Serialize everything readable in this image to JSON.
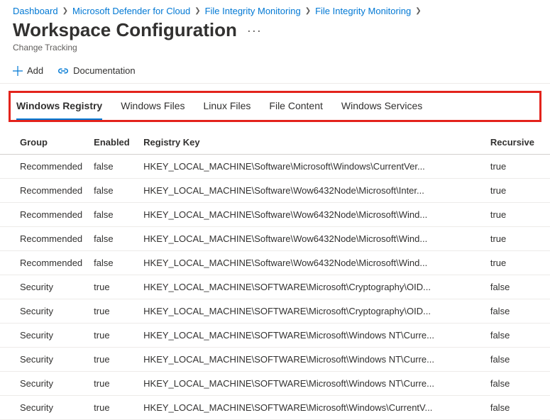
{
  "breadcrumb": {
    "items": [
      {
        "label": "Dashboard"
      },
      {
        "label": "Microsoft Defender for Cloud"
      },
      {
        "label": "File Integrity Monitoring"
      },
      {
        "label": "File Integrity Monitoring"
      }
    ]
  },
  "header": {
    "title": "Workspace Configuration",
    "subtitle": "Change Tracking"
  },
  "toolbar": {
    "add_label": "Add",
    "doc_label": "Documentation"
  },
  "tabs": [
    {
      "label": "Windows Registry",
      "active": true
    },
    {
      "label": "Windows Files",
      "active": false
    },
    {
      "label": "Linux Files",
      "active": false
    },
    {
      "label": "File Content",
      "active": false
    },
    {
      "label": "Windows Services",
      "active": false
    }
  ],
  "table": {
    "headers": {
      "group": "Group",
      "enabled": "Enabled",
      "key": "Registry Key",
      "recursive": "Recursive"
    },
    "rows": [
      {
        "group": "Recommended",
        "enabled": "false",
        "key": "HKEY_LOCAL_MACHINE\\Software\\Microsoft\\Windows\\CurrentVer...",
        "recursive": "true"
      },
      {
        "group": "Recommended",
        "enabled": "false",
        "key": "HKEY_LOCAL_MACHINE\\Software\\Wow6432Node\\Microsoft\\Inter...",
        "recursive": "true"
      },
      {
        "group": "Recommended",
        "enabled": "false",
        "key": "HKEY_LOCAL_MACHINE\\Software\\Wow6432Node\\Microsoft\\Wind...",
        "recursive": "true"
      },
      {
        "group": "Recommended",
        "enabled": "false",
        "key": "HKEY_LOCAL_MACHINE\\Software\\Wow6432Node\\Microsoft\\Wind...",
        "recursive": "true"
      },
      {
        "group": "Recommended",
        "enabled": "false",
        "key": "HKEY_LOCAL_MACHINE\\Software\\Wow6432Node\\Microsoft\\Wind...",
        "recursive": "true"
      },
      {
        "group": "Security",
        "enabled": "true",
        "key": "HKEY_LOCAL_MACHINE\\SOFTWARE\\Microsoft\\Cryptography\\OID...",
        "recursive": "false"
      },
      {
        "group": "Security",
        "enabled": "true",
        "key": "HKEY_LOCAL_MACHINE\\SOFTWARE\\Microsoft\\Cryptography\\OID...",
        "recursive": "false"
      },
      {
        "group": "Security",
        "enabled": "true",
        "key": "HKEY_LOCAL_MACHINE\\SOFTWARE\\Microsoft\\Windows NT\\Curre...",
        "recursive": "false"
      },
      {
        "group": "Security",
        "enabled": "true",
        "key": "HKEY_LOCAL_MACHINE\\SOFTWARE\\Microsoft\\Windows NT\\Curre...",
        "recursive": "false"
      },
      {
        "group": "Security",
        "enabled": "true",
        "key": "HKEY_LOCAL_MACHINE\\SOFTWARE\\Microsoft\\Windows NT\\Curre...",
        "recursive": "false"
      },
      {
        "group": "Security",
        "enabled": "true",
        "key": "HKEY_LOCAL_MACHINE\\SOFTWARE\\Microsoft\\Windows\\CurrentV...",
        "recursive": "false"
      }
    ]
  }
}
